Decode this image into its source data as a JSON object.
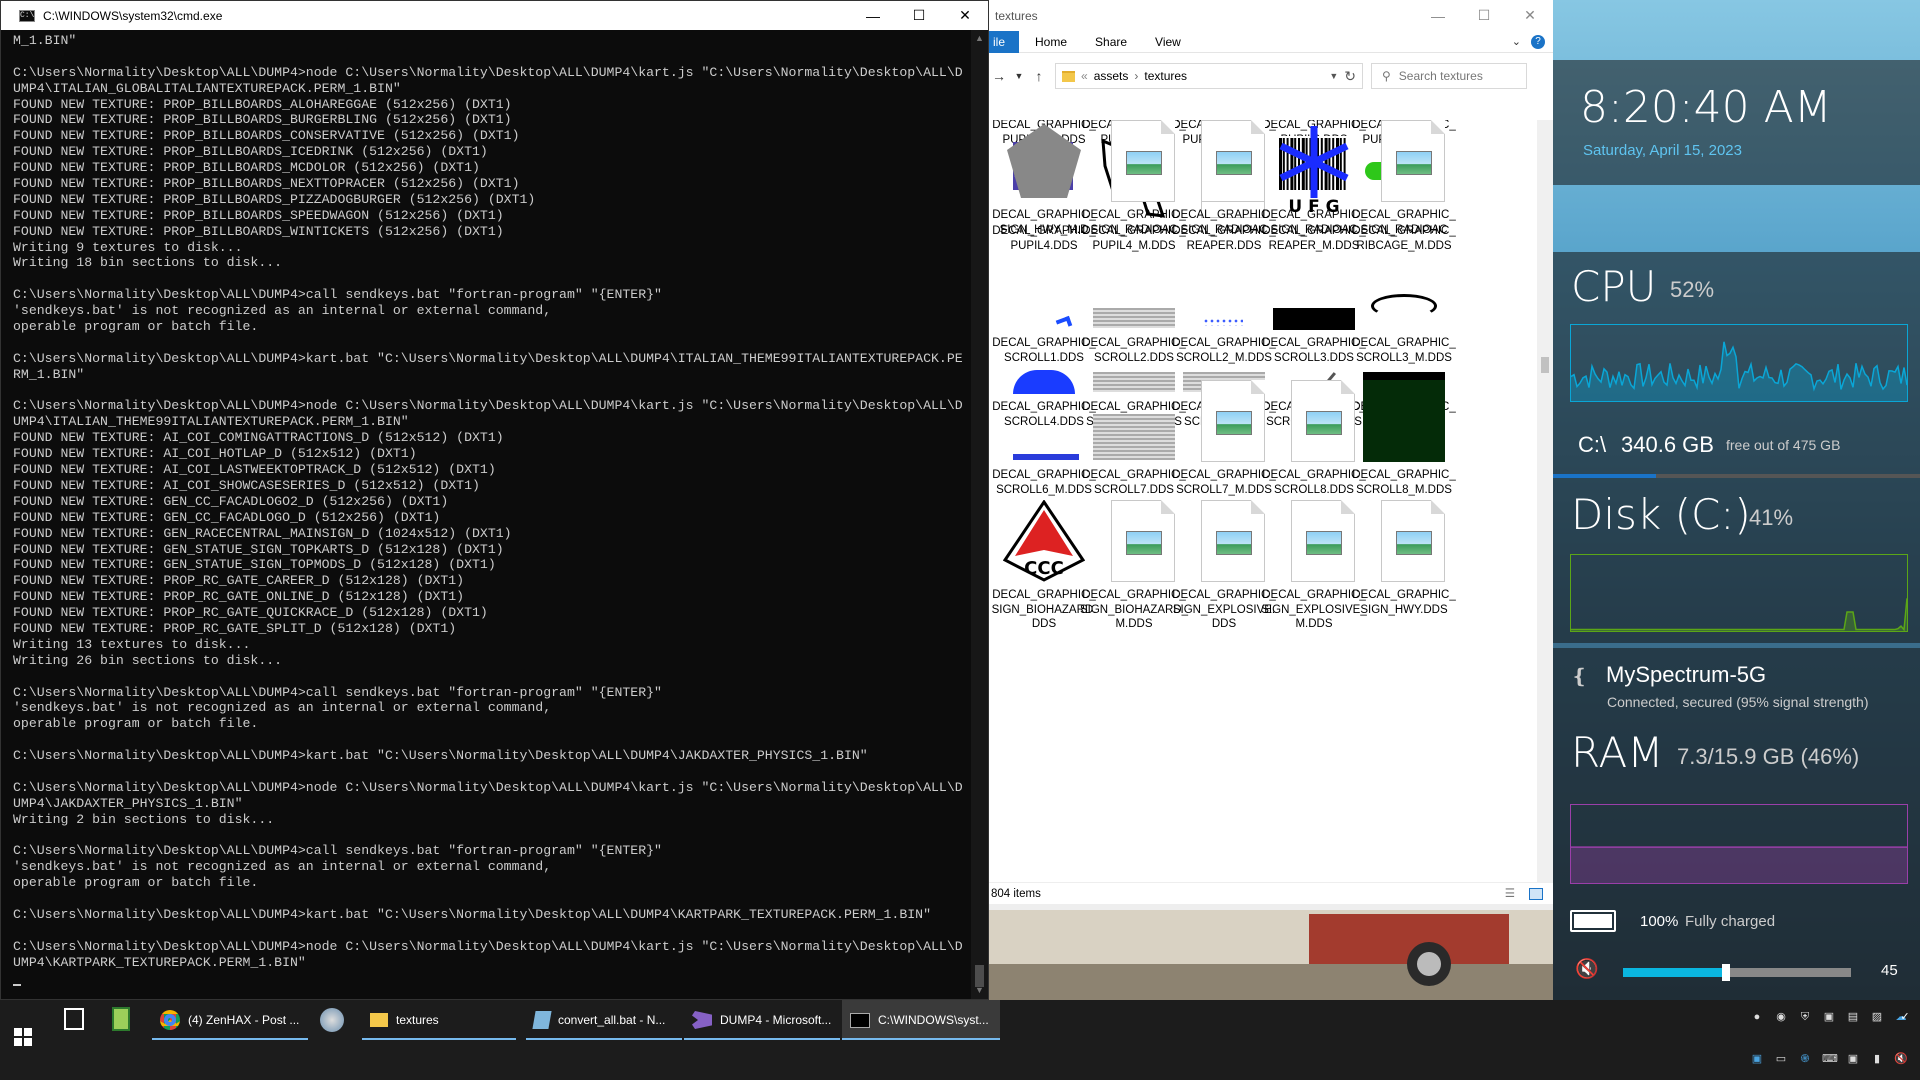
{
  "cmd": {
    "title": "C:\\WINDOWS\\system32\\cmd.exe",
    "lines": [
      "M_1.BIN\"",
      "",
      "C:\\Users\\Normality\\Desktop\\ALL\\DUMP4>node C:\\Users\\Normality\\Desktop\\ALL\\DUMP4\\kart.js \"C:\\Users\\Normality\\Desktop\\ALL\\D",
      "UMP4\\ITALIAN_GLOBALITALIANTEXTUREPACK.PERM_1.BIN\"",
      "FOUND NEW TEXTURE: PROP_BILLBOARDS_ALOHAREGGAE (512x256) (DXT1)",
      "FOUND NEW TEXTURE: PROP_BILLBOARDS_BURGERBLING (512x256) (DXT1)",
      "FOUND NEW TEXTURE: PROP_BILLBOARDS_CONSERVATIVE (512x256) (DXT1)",
      "FOUND NEW TEXTURE: PROP_BILLBOARDS_ICEDRINK (512x256) (DXT1)",
      "FOUND NEW TEXTURE: PROP_BILLBOARDS_MCDOLOR (512x256) (DXT1)",
      "FOUND NEW TEXTURE: PROP_BILLBOARDS_NEXTTOPRACER (512x256) (DXT1)",
      "FOUND NEW TEXTURE: PROP_BILLBOARDS_PIZZADOGBURGER (512x256) (DXT1)",
      "FOUND NEW TEXTURE: PROP_BILLBOARDS_SPEEDWAGON (512x256) (DXT1)",
      "FOUND NEW TEXTURE: PROP_BILLBOARDS_WINTICKETS (512x256) (DXT1)",
      "Writing 9 textures to disk...",
      "Writing 18 bin sections to disk...",
      "",
      "C:\\Users\\Normality\\Desktop\\ALL\\DUMP4>call sendkeys.bat \"fortran-program\" \"{ENTER}\"",
      "'sendkeys.bat' is not recognized as an internal or external command,",
      "operable program or batch file.",
      "",
      "C:\\Users\\Normality\\Desktop\\ALL\\DUMP4>kart.bat \"C:\\Users\\Normality\\Desktop\\ALL\\DUMP4\\ITALIAN_THEME99ITALIANTEXTUREPACK.PE",
      "RM_1.BIN\"",
      "",
      "C:\\Users\\Normality\\Desktop\\ALL\\DUMP4>node C:\\Users\\Normality\\Desktop\\ALL\\DUMP4\\kart.js \"C:\\Users\\Normality\\Desktop\\ALL\\D",
      "UMP4\\ITALIAN_THEME99ITALIANTEXTUREPACK.PERM_1.BIN\"",
      "FOUND NEW TEXTURE: AI_COI_COMINGATTRACTIONS_D (512x512) (DXT1)",
      "FOUND NEW TEXTURE: AI_COI_HOTLAP_D (512x512) (DXT1)",
      "FOUND NEW TEXTURE: AI_COI_LASTWEEKTOPTRACK_D (512x512) (DXT1)",
      "FOUND NEW TEXTURE: AI_COI_SHOWCASESERIES_D (512x512) (DXT1)",
      "FOUND NEW TEXTURE: GEN_CC_FACADLOGO2_D (512x256) (DXT1)",
      "FOUND NEW TEXTURE: GEN_CC_FACADLOGO_D (512x256) (DXT1)",
      "FOUND NEW TEXTURE: GEN_RACECENTRAL_MAINSIGN_D (1024x512) (DXT1)",
      "FOUND NEW TEXTURE: GEN_STATUE_SIGN_TOPKARTS_D (512x128) (DXT1)",
      "FOUND NEW TEXTURE: GEN_STATUE_SIGN_TOPMODS_D (512x128) (DXT1)",
      "FOUND NEW TEXTURE: PROP_RC_GATE_CAREER_D (512x128) (DXT1)",
      "FOUND NEW TEXTURE: PROP_RC_GATE_ONLINE_D (512x128) (DXT1)",
      "FOUND NEW TEXTURE: PROP_RC_GATE_QUICKRACE_D (512x128) (DXT1)",
      "FOUND NEW TEXTURE: PROP_RC_GATE_SPLIT_D (512x128) (DXT1)",
      "Writing 13 textures to disk...",
      "Writing 26 bin sections to disk...",
      "",
      "C:\\Users\\Normality\\Desktop\\ALL\\DUMP4>call sendkeys.bat \"fortran-program\" \"{ENTER}\"",
      "'sendkeys.bat' is not recognized as an internal or external command,",
      "operable program or batch file.",
      "",
      "C:\\Users\\Normality\\Desktop\\ALL\\DUMP4>kart.bat \"C:\\Users\\Normality\\Desktop\\ALL\\DUMP4\\JAKDAXTER_PHYSICS_1.BIN\"",
      "",
      "C:\\Users\\Normality\\Desktop\\ALL\\DUMP4>node C:\\Users\\Normality\\Desktop\\ALL\\DUMP4\\kart.js \"C:\\Users\\Normality\\Desktop\\ALL\\D",
      "UMP4\\JAKDAXTER_PHYSICS_1.BIN\"",
      "Writing 2 bin sections to disk...",
      "",
      "C:\\Users\\Normality\\Desktop\\ALL\\DUMP4>call sendkeys.bat \"fortran-program\" \"{ENTER}\"",
      "'sendkeys.bat' is not recognized as an internal or external command,",
      "operable program or batch file.",
      "",
      "C:\\Users\\Normality\\Desktop\\ALL\\DUMP4>kart.bat \"C:\\Users\\Normality\\Desktop\\ALL\\DUMP4\\KARTPARK_TEXTUREPACK.PERM_1.BIN\"",
      "",
      "C:\\Users\\Normality\\Desktop\\ALL\\DUMP4>node C:\\Users\\Normality\\Desktop\\ALL\\DUMP4\\kart.js \"C:\\Users\\Normality\\Desktop\\ALL\\D",
      "UMP4\\KARTPARK_TEXTUREPACK.PERM_1.BIN\""
    ]
  },
  "explorer": {
    "title": "textures",
    "ribbon": {
      "file": "ile",
      "home": "Home",
      "share": "Share",
      "view": "View"
    },
    "path": {
      "parent": "assets",
      "current": "textures"
    },
    "search_placeholder": "Search textures",
    "status": "804 items",
    "items": [
      {
        "label": "DECAL_GRAPHIC_PUPIL1_M.DDS",
        "thumb": "none"
      },
      {
        "label": "DECAL_GRAPHIC_PUPIL2.DDS",
        "thumb": "none"
      },
      {
        "label": "DECAL_GRAPHIC_PUPIL2_M.DDS",
        "thumb": "none"
      },
      {
        "label": "DECAL_GRAPHIC_PUPIL3.DDS",
        "thumb": "none"
      },
      {
        "label": "DECAL_GRAPHIC_PUPIL3_M.DDS",
        "thumb": "none"
      },
      {
        "label": "DECAL_GRAPHIC_PUPIL4.DDS",
        "thumb": "iii3-logo",
        "logo_text": "iii3"
      },
      {
        "label": "DECAL_GRAPHIC_PUPIL4_M.DDS",
        "thumb": "white-splash"
      },
      {
        "label": "DECAL_GRAPHIC_REAPER.DDS",
        "thumb": "doc"
      },
      {
        "label": "DECAL_GRAPHIC_REAPER_M.DDS",
        "thumb": "barcode",
        "logo_text": "U F G"
      },
      {
        "label": "DECAL_GRAPHIC_RIBCAGE_M.DDS",
        "thumb": "green-bar"
      },
      {
        "label": "DECAL_GRAPHIC_SCROLL1.DDS",
        "thumb": "blue-flick"
      },
      {
        "label": "DECAL_GRAPHIC_SCROLL2.DDS",
        "thumb": "gray-lines"
      },
      {
        "label": "DECAL_GRAPHIC_SCROLL2_M.DDS",
        "thumb": "blue-dots"
      },
      {
        "label": "DECAL_GRAPHIC_SCROLL3.DDS",
        "thumb": "black-bar"
      },
      {
        "label": "DECAL_GRAPHIC_SCROLL3_M.DDS",
        "thumb": "white-swirl"
      },
      {
        "label": "DECAL_GRAPHIC_SCROLL4.DDS",
        "thumb": "blue-dome"
      },
      {
        "label": "DECAL_GRAPHIC_SCROLL4_M.DDS",
        "thumb": "gray-lines"
      },
      {
        "label": "DECAL_GRAPHIC_SCROLL5.DDS",
        "thumb": "gray-lines"
      },
      {
        "label": "DECAL_GRAPHIC_SCROLL5_M.DDS",
        "thumb": "quill"
      },
      {
        "label": "DECAL_GRAPHIC_SCROLL6.DDS",
        "thumb": "black-bar"
      },
      {
        "label": "DECAL_GRAPHIC_SCROLL6_M.DDS",
        "thumb": "blue-text-strip"
      },
      {
        "label": "DECAL_GRAPHIC_SCROLL7.DDS",
        "thumb": "gray-block"
      },
      {
        "label": "DECAL_GRAPHIC_SCROLL7_M.DDS",
        "thumb": "doc"
      },
      {
        "label": "DECAL_GRAPHIC_SCROLL8.DDS",
        "thumb": "doc"
      },
      {
        "label": "DECAL_GRAPHIC_SCROLL8_M.DDS",
        "thumb": "dark-green"
      },
      {
        "label": "DECAL_GRAPHIC_SIGN_BIOHAZARD.DDS",
        "thumb": "ccc-logo",
        "logo_text": "CCC"
      },
      {
        "label": "DECAL_GRAPHIC_SIGN_BIOHAZARD_M.DDS",
        "thumb": "doc"
      },
      {
        "label": "DECAL_GRAPHIC_SIGN_EXPLOSIVE.DDS",
        "thumb": "doc"
      },
      {
        "label": "DECAL_GRAPHIC_SIGN_EXPLOSIVE_M.DDS",
        "thumb": "doc"
      },
      {
        "label": "DECAL_GRAPHIC_SIGN_HWY.DDS",
        "thumb": "doc"
      },
      {
        "label": "DECAL_GRAPHIC_SIGN_HWY_M.D",
        "thumb": "pentagon"
      },
      {
        "label": "DECAL_GRAPHIC_SIGN_RADIOAC",
        "thumb": "doc"
      },
      {
        "label": "DECAL_GRAPHIC_SIGN_RADIOAC",
        "thumb": "doc"
      },
      {
        "label": "DECAL_GRAPHIC_SIGN_RADIOAC",
        "thumb": "blue-star"
      },
      {
        "label": "DECAL_GRAPHIC_SIGN_RADIOAC",
        "thumb": "doc"
      }
    ]
  },
  "widgets": {
    "time": "8:20:40 AM",
    "date": "Saturday, April 15, 2023",
    "cpu": {
      "label": "CPU",
      "value": "52%",
      "color": "#0aa6d6"
    },
    "disk_space": {
      "drive": "C:\\",
      "free": "340.6 GB",
      "suffix": "free out of 475 GB",
      "used_fraction": 0.28
    },
    "disk": {
      "label": "Disk (C:)",
      "value": "41%",
      "color": "#5ba617"
    },
    "wifi": {
      "name": "MySpectrum-5G",
      "status": "Connected, secured (95% signal strength)"
    },
    "ram": {
      "label": "RAM",
      "value": "7.3/15.9 GB (46%)",
      "color": "#9a3fa9"
    },
    "battery": {
      "percent": "100%",
      "status": "Fully charged"
    },
    "volume": {
      "value": "45",
      "level": 0.45
    }
  },
  "taskbar": {
    "items": [
      {
        "label": "(4) ZenHAX - Post ..."
      },
      {
        "label": "textures"
      },
      {
        "label": "convert_all.bat - N..."
      },
      {
        "label": "DUMP4 - Microsoft..."
      },
      {
        "label": "C:\\WINDOWS\\syst..."
      }
    ]
  }
}
